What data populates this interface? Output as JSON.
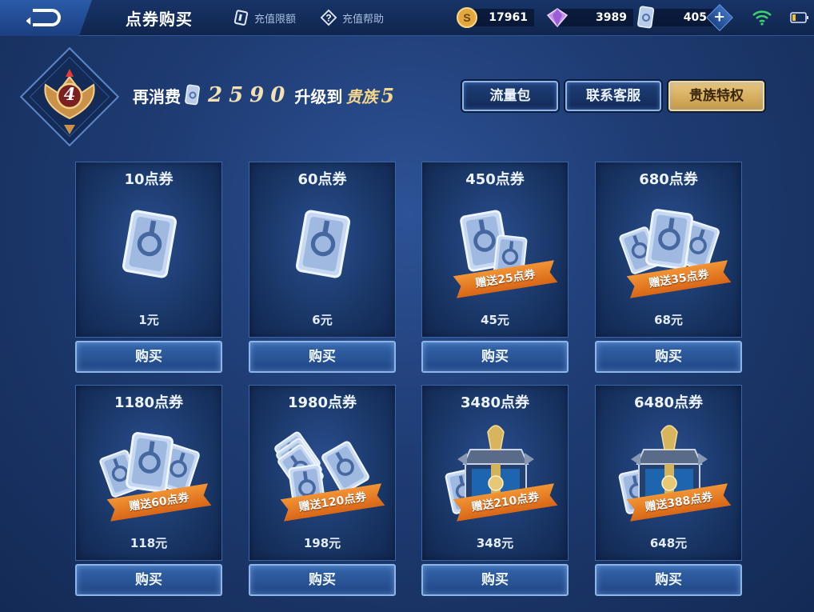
{
  "topbar": {
    "title": "点券购买",
    "links": [
      {
        "label": "充值限额",
        "icon": "card-icon"
      },
      {
        "label": "充值帮助",
        "icon": "help-icon"
      }
    ],
    "currencies": [
      {
        "name": "gold-coin",
        "icon": "coin-icon",
        "value": "17961"
      },
      {
        "name": "diamond",
        "icon": "diamond-icon",
        "value": "3989"
      },
      {
        "name": "voucher",
        "icon": "voucher-icon",
        "value": "405"
      }
    ],
    "wifi_icon": "wifi-icon",
    "battery_icon": "battery-icon"
  },
  "vip": {
    "level": "4",
    "prefix": "再消费",
    "amount": "2590",
    "mid": "升级到",
    "rank_name": "贵族",
    "rank_level": "5"
  },
  "actions": [
    {
      "label": "流量包",
      "style": "blue"
    },
    {
      "label": "联系客服",
      "style": "blue"
    },
    {
      "label": "贵族特权",
      "style": "gold"
    }
  ],
  "packs": [
    {
      "title": "10点券",
      "price": "1元",
      "bonus": "",
      "art": "single-ticket",
      "buy": "购买"
    },
    {
      "title": "60点券",
      "price": "6元",
      "bonus": "",
      "art": "single-ticket",
      "buy": "购买"
    },
    {
      "title": "450点券",
      "price": "45元",
      "bonus": "赠送25点券",
      "art": "two-tickets",
      "buy": "购买"
    },
    {
      "title": "680点券",
      "price": "68元",
      "bonus": "赠送35点券",
      "art": "fan-tickets",
      "buy": "购买"
    },
    {
      "title": "1180点券",
      "price": "118元",
      "bonus": "赠送60点券",
      "art": "fan-tickets",
      "buy": "购买"
    },
    {
      "title": "1980点券",
      "price": "198元",
      "bonus": "赠送120点券",
      "art": "stack-tickets",
      "buy": "购买"
    },
    {
      "title": "3480点券",
      "price": "348元",
      "bonus": "赠送210点券",
      "art": "chest",
      "buy": "购买"
    },
    {
      "title": "6480点券",
      "price": "648元",
      "bonus": "赠送388点券",
      "art": "chest",
      "buy": "购买"
    }
  ],
  "colors": {
    "background": "#1e3b72",
    "card": "#193666",
    "bonus": "#e07420",
    "gold_button": "#dcb468",
    "accent_text": "#f5d68a"
  }
}
